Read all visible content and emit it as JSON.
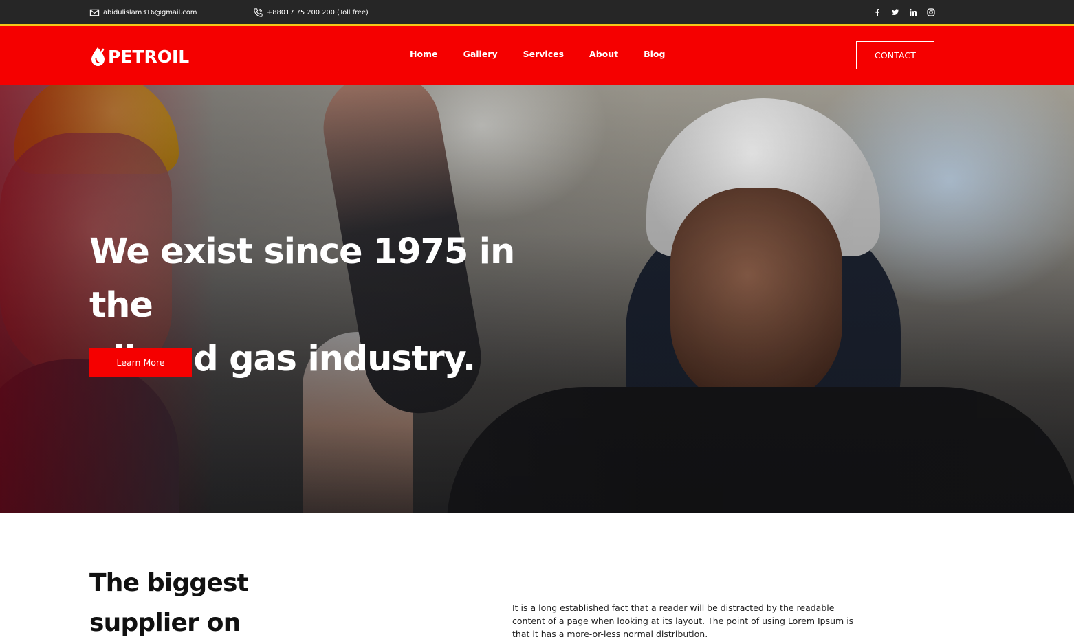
{
  "topbar": {
    "email": "abidulislam316@gmail.com",
    "phone": "+88017 75 200 200 (Toll free)",
    "accent_line_color": "#f5c518",
    "icons": [
      "mail-icon",
      "phone-icon",
      "facebook-icon",
      "twitter-icon",
      "linkedin-icon",
      "instagram-icon"
    ]
  },
  "header": {
    "logo_text": "PETROIL",
    "nav": [
      "Home",
      "Gallery",
      "Services",
      "About",
      "Blog"
    ],
    "contact_label": "CONTACT",
    "brand_color": "#f50000"
  },
  "hero": {
    "title_line1": "We exist since 1975 in the",
    "title_line2": "oil and gas industry.",
    "cta_label": "Learn More"
  },
  "about": {
    "title_line1": "The biggest",
    "title_line2": "supplier on",
    "body": "It is a long established fact that a reader will be distracted by the readable content of a page when looking at its layout. The point of using Lorem Ipsum is that it has a more-or-less normal distribution."
  }
}
